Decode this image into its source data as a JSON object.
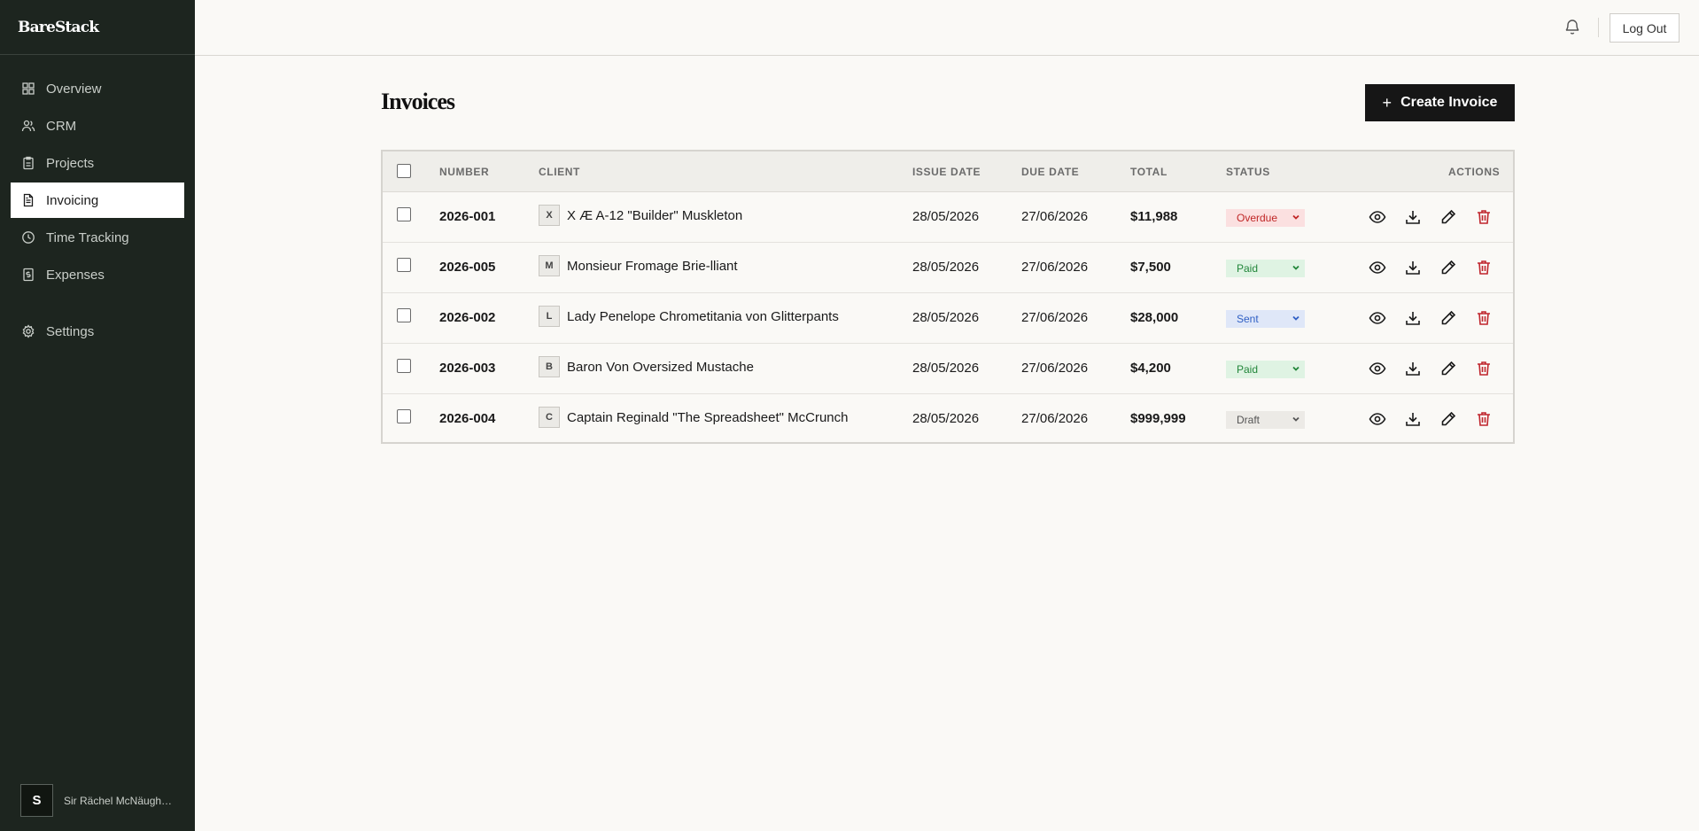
{
  "brand": "BareStack",
  "sidebar": {
    "items": [
      {
        "label": "Overview",
        "icon": "grid-icon"
      },
      {
        "label": "CRM",
        "icon": "users-icon"
      },
      {
        "label": "Projects",
        "icon": "clipboard-icon"
      },
      {
        "label": "Invoicing",
        "icon": "file-text-icon",
        "active": true
      },
      {
        "label": "Time Tracking",
        "icon": "clock-icon"
      },
      {
        "label": "Expenses",
        "icon": "receipt-icon"
      }
    ],
    "settings": {
      "label": "Settings",
      "icon": "gear-icon"
    },
    "user": {
      "initial": "S",
      "name": "Sir Rächel McNäughtington"
    }
  },
  "header": {
    "logout_label": "Log Out"
  },
  "main": {
    "title": "Invoices",
    "create_label": "Create Invoice"
  },
  "table": {
    "columns": {
      "number": "NUMBER",
      "client": "CLIENT",
      "issue_date": "ISSUE DATE",
      "due_date": "DUE DATE",
      "total": "TOTAL",
      "status": "STATUS",
      "actions": "ACTIONS"
    },
    "rows": [
      {
        "number": "2026-001",
        "initial": "X",
        "client": "X Æ A-12 \"Builder\" Muskleton",
        "issue_date": "28/05/2026",
        "due_date": "27/06/2026",
        "total": "$11,988",
        "status": "Overdue"
      },
      {
        "number": "2026-005",
        "initial": "M",
        "client": "Monsieur Fromage Brie-lliant",
        "issue_date": "28/05/2026",
        "due_date": "27/06/2026",
        "total": "$7,500",
        "status": "Paid"
      },
      {
        "number": "2026-002",
        "initial": "L",
        "client": "Lady Penelope Chrometitania von Glitterpants",
        "issue_date": "28/05/2026",
        "due_date": "27/06/2026",
        "total": "$28,000",
        "status": "Sent"
      },
      {
        "number": "2026-003",
        "initial": "B",
        "client": "Baron Von Oversized Mustache",
        "issue_date": "28/05/2026",
        "due_date": "27/06/2026",
        "total": "$4,200",
        "status": "Paid"
      },
      {
        "number": "2026-004",
        "initial": "C",
        "client": "Captain Reginald \"The Spreadsheet\" McCrunch",
        "issue_date": "28/05/2026",
        "due_date": "27/06/2026",
        "total": "$999,999",
        "status": "Draft"
      }
    ]
  },
  "colors": {
    "sidebar_bg": "#1d251f",
    "primary_button": "#161616",
    "overdue": "#c02626",
    "paid": "#22863a",
    "sent": "#2f5fc4",
    "delete_icon": "#c0262d"
  }
}
